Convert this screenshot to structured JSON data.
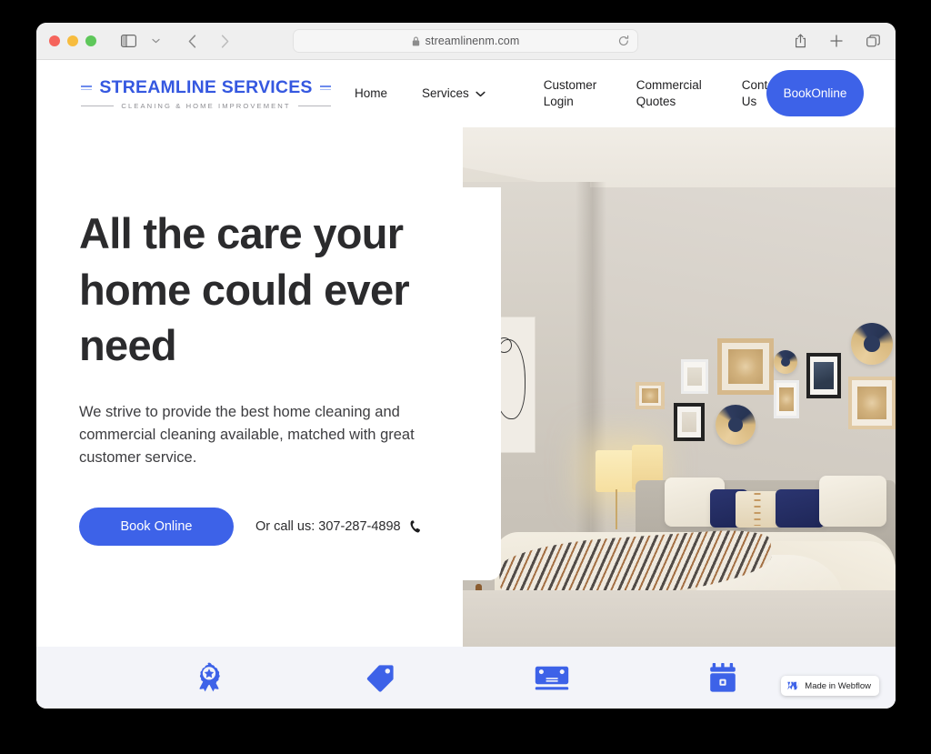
{
  "browser": {
    "url": "streamlinenm.com",
    "icons": {
      "sidebar": "sidebar-toggle-icon",
      "sidebar_chevron": "chevron-down-icon",
      "back": "back-arrow-icon",
      "forward": "forward-arrow-icon",
      "lock": "lock-icon",
      "reload": "reload-icon",
      "share": "share-icon",
      "new_tab": "plus-icon",
      "tabs": "tabs-overview-icon"
    },
    "traffic_lights": [
      "close",
      "minimize",
      "maximize"
    ]
  },
  "site": {
    "logo": {
      "word": "STREAMLINE SERVICES",
      "tagline": "CLEANING & HOME IMPROVEMENT"
    },
    "nav": [
      {
        "label": "Home"
      },
      {
        "label": "Services",
        "has_dropdown": true
      },
      {
        "label_line1": "Customer",
        "label_line2": "Login"
      },
      {
        "label_line1": "Commercial",
        "label_line2": "Quotes"
      },
      {
        "label_line1": "Contact",
        "label_line2": "Us"
      }
    ],
    "header_cta": {
      "line1": "Book",
      "line2": "Online"
    }
  },
  "hero": {
    "title": "All the care your home could ever need",
    "subtitle": "We strive to provide the best home cleaning and commercial cleaning available, matched with great customer service.",
    "cta_label": "Book Online",
    "phone_prefix": "Or call us:",
    "phone_number": "307-287-4898",
    "phone_text": "Or call us: 307-287-4898",
    "image_alt": "Bedroom interior with gallery wall, bed with navy pillows and wooden bench"
  },
  "features": [
    {
      "icon": "award-ribbon-icon"
    },
    {
      "icon": "price-tag-icon"
    },
    {
      "icon": "credit-card-icon"
    },
    {
      "icon": "calendar-icon"
    }
  ],
  "webflow_badge": {
    "text": "Made in Webflow",
    "mark": "webflow-logo-icon"
  },
  "colors": {
    "brand_blue": "#3d62e8",
    "logo_blue": "#3558e0",
    "heading": "#2b2b2d",
    "strip_bg": "#f3f4f9",
    "toolbar_bg": "#efefef"
  }
}
